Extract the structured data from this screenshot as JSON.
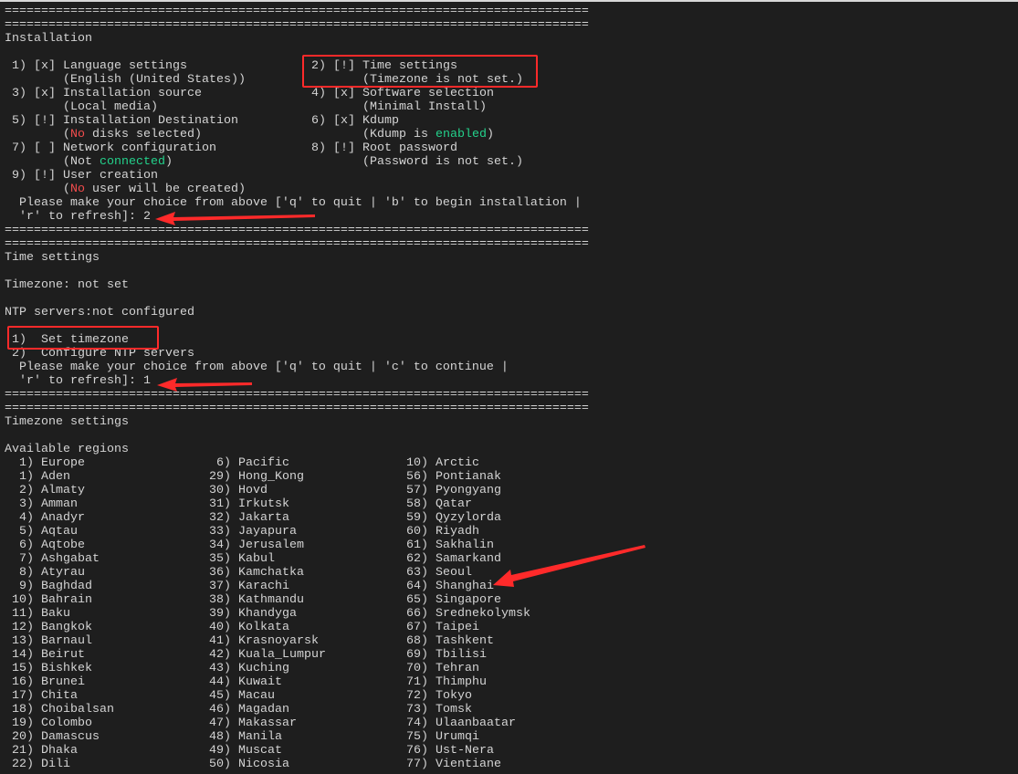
{
  "divider": "================================================================================",
  "installation": {
    "title": "Installation",
    "items": [
      {
        "num": "1)",
        "status": "[x]",
        "label": "Language settings",
        "detail": [
          {
            "t": "(English (United States))"
          }
        ]
      },
      {
        "num": "2)",
        "status": "[!]",
        "label": "Time settings",
        "detail": [
          {
            "t": "(Timezone is not set.)"
          }
        ]
      },
      {
        "num": "3)",
        "status": "[x]",
        "label": "Installation source",
        "detail": [
          {
            "t": "(Local media)"
          }
        ]
      },
      {
        "num": "4)",
        "status": "[x]",
        "label": "Software selection",
        "detail": [
          {
            "t": "(Minimal Install)"
          }
        ]
      },
      {
        "num": "5)",
        "status": "[!]",
        "label": "Installation Destination",
        "detail": [
          {
            "t": "("
          },
          {
            "t": "No",
            "c": "red"
          },
          {
            "t": " disks selected)"
          }
        ]
      },
      {
        "num": "6)",
        "status": "[x]",
        "label": "Kdump",
        "detail": [
          {
            "t": "(Kdump is "
          },
          {
            "t": "enabled",
            "c": "green"
          },
          {
            "t": ")"
          }
        ]
      },
      {
        "num": "7)",
        "status": "[ ]",
        "label": "Network configuration",
        "detail": [
          {
            "t": "(Not "
          },
          {
            "t": "connected",
            "c": "green"
          },
          {
            "t": ")"
          }
        ]
      },
      {
        "num": "8)",
        "status": "[!]",
        "label": "Root password",
        "detail": [
          {
            "t": "(Password is not set.)"
          }
        ]
      },
      {
        "num": "9)",
        "status": "[!]",
        "label": "User creation",
        "detail": [
          {
            "t": "("
          },
          {
            "t": "No",
            "c": "red"
          },
          {
            "t": " user will be created)"
          }
        ]
      }
    ],
    "prompt_line1": "Please make your choice from above ['q' to quit | 'b' to begin installation |",
    "prompt_line2": "'r' to refresh]: 2"
  },
  "time_settings": {
    "title": "Time settings",
    "timezone": "Timezone: not set",
    "ntp": "NTP servers:not configured",
    "options": [
      {
        "num": "1)",
        "label": "Set timezone"
      },
      {
        "num": "2)",
        "label": "Configure NTP servers"
      }
    ],
    "prompt_line1": "Please make your choice from above ['q' to quit | 'c' to continue |",
    "prompt_line2": "'r' to refresh]: 1"
  },
  "timezone_settings": {
    "title": "Timezone settings",
    "subtitle": "Available regions",
    "columns": [
      [
        {
          "num": "1)",
          "name": "Europe"
        },
        {
          "num": "1)",
          "name": "Aden"
        },
        {
          "num": "2)",
          "name": "Almaty"
        },
        {
          "num": "3)",
          "name": "Amman"
        },
        {
          "num": "4)",
          "name": "Anadyr"
        },
        {
          "num": "5)",
          "name": "Aqtau"
        },
        {
          "num": "6)",
          "name": "Aqtobe"
        },
        {
          "num": "7)",
          "name": "Ashgabat"
        },
        {
          "num": "8)",
          "name": "Atyrau"
        },
        {
          "num": "9)",
          "name": "Baghdad"
        },
        {
          "num": "10)",
          "name": "Bahrain"
        },
        {
          "num": "11)",
          "name": "Baku"
        },
        {
          "num": "12)",
          "name": "Bangkok"
        },
        {
          "num": "13)",
          "name": "Barnaul"
        },
        {
          "num": "14)",
          "name": "Beirut"
        },
        {
          "num": "15)",
          "name": "Bishkek"
        },
        {
          "num": "16)",
          "name": "Brunei"
        },
        {
          "num": "17)",
          "name": "Chita"
        },
        {
          "num": "18)",
          "name": "Choibalsan"
        },
        {
          "num": "19)",
          "name": "Colombo"
        },
        {
          "num": "20)",
          "name": "Damascus"
        },
        {
          "num": "21)",
          "name": "Dhaka"
        },
        {
          "num": "22)",
          "name": "Dili"
        }
      ],
      [
        {
          "num": "6)",
          "name": "Pacific"
        },
        {
          "num": "29)",
          "name": "Hong_Kong"
        },
        {
          "num": "30)",
          "name": "Hovd"
        },
        {
          "num": "31)",
          "name": "Irkutsk"
        },
        {
          "num": "32)",
          "name": "Jakarta"
        },
        {
          "num": "33)",
          "name": "Jayapura"
        },
        {
          "num": "34)",
          "name": "Jerusalem"
        },
        {
          "num": "35)",
          "name": "Kabul"
        },
        {
          "num": "36)",
          "name": "Kamchatka"
        },
        {
          "num": "37)",
          "name": "Karachi"
        },
        {
          "num": "38)",
          "name": "Kathmandu"
        },
        {
          "num": "39)",
          "name": "Khandyga"
        },
        {
          "num": "40)",
          "name": "Kolkata"
        },
        {
          "num": "41)",
          "name": "Krasnoyarsk"
        },
        {
          "num": "42)",
          "name": "Kuala_Lumpur"
        },
        {
          "num": "43)",
          "name": "Kuching"
        },
        {
          "num": "44)",
          "name": "Kuwait"
        },
        {
          "num": "45)",
          "name": "Macau"
        },
        {
          "num": "46)",
          "name": "Magadan"
        },
        {
          "num": "47)",
          "name": "Makassar"
        },
        {
          "num": "48)",
          "name": "Manila"
        },
        {
          "num": "49)",
          "name": "Muscat"
        },
        {
          "num": "50)",
          "name": "Nicosia"
        }
      ],
      [
        {
          "num": "10)",
          "name": "Arctic"
        },
        {
          "num": "56)",
          "name": "Pontianak"
        },
        {
          "num": "57)",
          "name": "Pyongyang"
        },
        {
          "num": "58)",
          "name": "Qatar"
        },
        {
          "num": "59)",
          "name": "Qyzylorda"
        },
        {
          "num": "60)",
          "name": "Riyadh"
        },
        {
          "num": "61)",
          "name": "Sakhalin"
        },
        {
          "num": "62)",
          "name": "Samarkand"
        },
        {
          "num": "63)",
          "name": "Seoul"
        },
        {
          "num": "64)",
          "name": "Shanghai"
        },
        {
          "num": "65)",
          "name": "Singapore"
        },
        {
          "num": "66)",
          "name": "Srednekolymsk"
        },
        {
          "num": "67)",
          "name": "Taipei"
        },
        {
          "num": "68)",
          "name": "Tashkent"
        },
        {
          "num": "69)",
          "name": "Tbilisi"
        },
        {
          "num": "70)",
          "name": "Tehran"
        },
        {
          "num": "71)",
          "name": "Thimphu"
        },
        {
          "num": "72)",
          "name": "Tokyo"
        },
        {
          "num": "73)",
          "name": "Tomsk"
        },
        {
          "num": "74)",
          "name": "Ulaanbaatar"
        },
        {
          "num": "75)",
          "name": "Urumqi"
        },
        {
          "num": "76)",
          "name": "Ust-Nera"
        },
        {
          "num": "77)",
          "name": "Vientiane"
        }
      ]
    ]
  },
  "colors": {
    "background": "#1e1e1e",
    "text": "#d4d4d4",
    "error": "#f14c4c",
    "ok": "#23d18b",
    "annotation": "#ff2a2a"
  }
}
